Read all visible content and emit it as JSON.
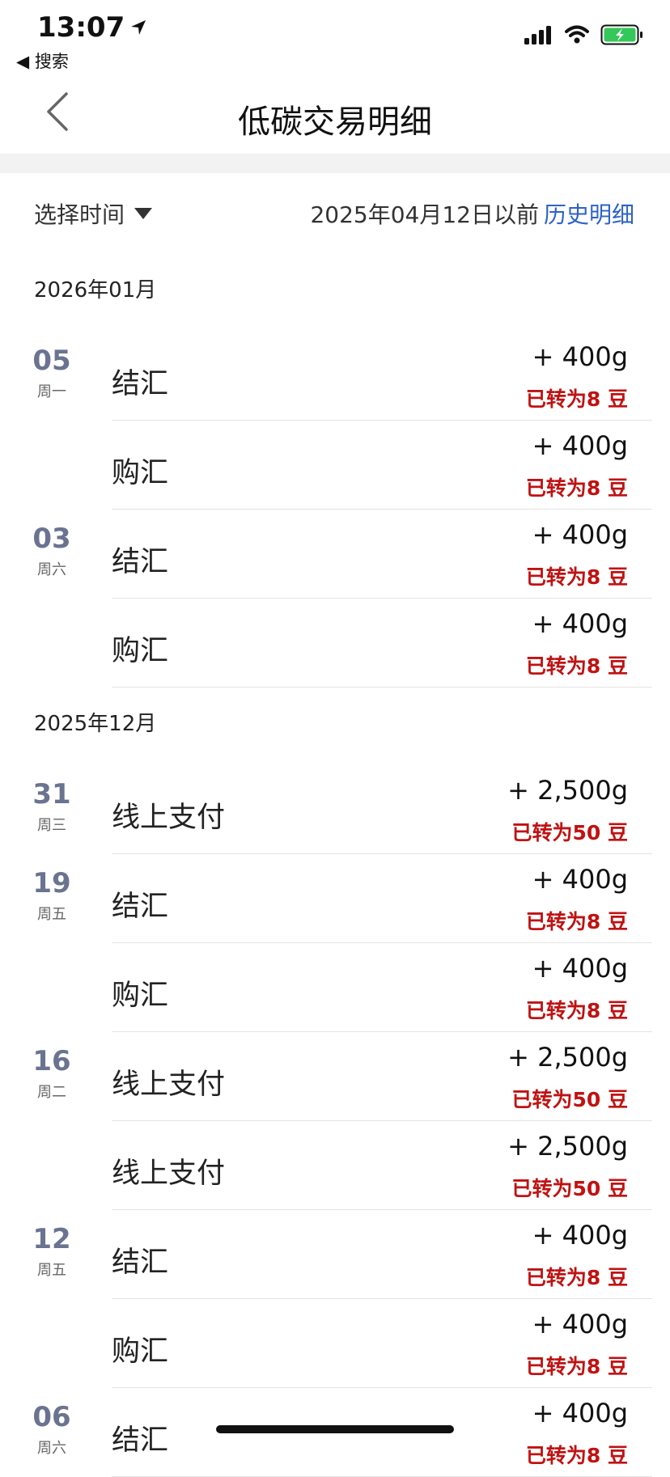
{
  "status_bar": {
    "time": "13:07",
    "back_app": "搜索"
  },
  "nav": {
    "title": "低碳交易明细"
  },
  "filter": {
    "select_label": "选择时间",
    "date_note": "2025年04月12日以前",
    "history_link": "历史明细"
  },
  "months": [
    {
      "label": "2026年01月",
      "days": [
        {
          "day": "05",
          "weekday": "周一",
          "items": [
            {
              "title": "结汇",
              "amount": "+ 400g",
              "beans": "已转为8 豆"
            },
            {
              "title": "购汇",
              "amount": "+ 400g",
              "beans": "已转为8 豆"
            }
          ]
        },
        {
          "day": "03",
          "weekday": "周六",
          "items": [
            {
              "title": "结汇",
              "amount": "+ 400g",
              "beans": "已转为8 豆"
            },
            {
              "title": "购汇",
              "amount": "+ 400g",
              "beans": "已转为8 豆"
            }
          ]
        }
      ]
    },
    {
      "label": "2025年12月",
      "days": [
        {
          "day": "31",
          "weekday": "周三",
          "items": [
            {
              "title": "线上支付",
              "amount": "+ 2,500g",
              "beans": "已转为50 豆"
            }
          ]
        },
        {
          "day": "19",
          "weekday": "周五",
          "items": [
            {
              "title": "结汇",
              "amount": "+ 400g",
              "beans": "已转为8 豆"
            },
            {
              "title": "购汇",
              "amount": "+ 400g",
              "beans": "已转为8 豆"
            }
          ]
        },
        {
          "day": "16",
          "weekday": "周二",
          "items": [
            {
              "title": "线上支付",
              "amount": "+ 2,500g",
              "beans": "已转为50 豆"
            },
            {
              "title": "线上支付",
              "amount": "+ 2,500g",
              "beans": "已转为50 豆"
            }
          ]
        },
        {
          "day": "12",
          "weekday": "周五",
          "items": [
            {
              "title": "结汇",
              "amount": "+ 400g",
              "beans": "已转为8 豆"
            },
            {
              "title": "购汇",
              "amount": "+ 400g",
              "beans": "已转为8 豆"
            }
          ]
        },
        {
          "day": "06",
          "weekday": "周六",
          "items": [
            {
              "title": "结汇",
              "amount": "+ 400g",
              "beans": "已转为8 豆"
            }
          ]
        }
      ]
    }
  ],
  "colors": {
    "link": "#2d62c8",
    "beans": "#c01212",
    "day_number": "#6a7390",
    "battery": "#34c759"
  }
}
